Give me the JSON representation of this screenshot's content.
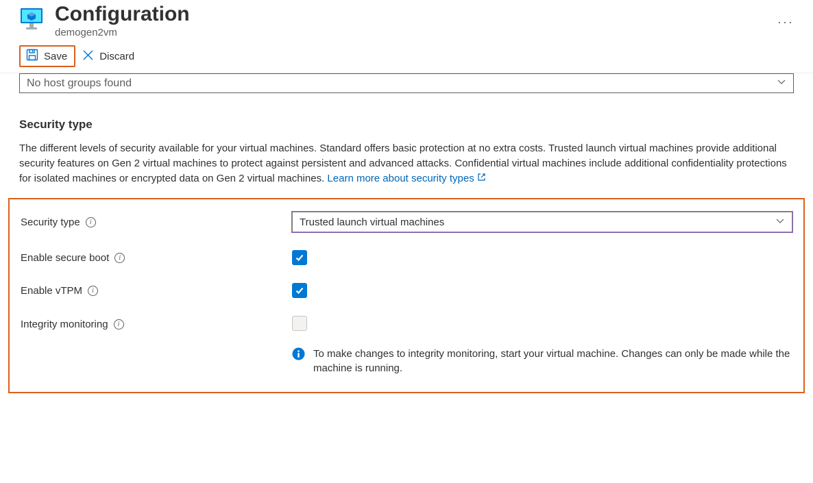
{
  "header": {
    "title": "Configuration",
    "subtitle": "demogen2vm"
  },
  "toolbar": {
    "save_label": "Save",
    "discard_label": "Discard"
  },
  "host_group": {
    "placeholder": "No host groups found"
  },
  "security": {
    "section_title": "Security type",
    "description": "The different levels of security available for your virtual machines. Standard offers basic protection at no extra costs. Trusted launch virtual machines provide additional security features on Gen 2 virtual machines to protect against persistent and advanced attacks. Confidential virtual machines include additional confidentiality protections for isolated machines or encrypted data on Gen 2 virtual machines.",
    "learn_more_label": "Learn more about security types",
    "fields": {
      "security_type_label": "Security type",
      "security_type_value": "Trusted launch virtual machines",
      "secure_boot_label": "Enable secure boot",
      "secure_boot_checked": true,
      "vtpm_label": "Enable vTPM",
      "vtpm_checked": true,
      "integrity_label": "Integrity monitoring",
      "integrity_checked": false
    },
    "info_message": "To make changes to integrity monitoring, start your virtual machine. Changes can only be made while the machine is running."
  }
}
